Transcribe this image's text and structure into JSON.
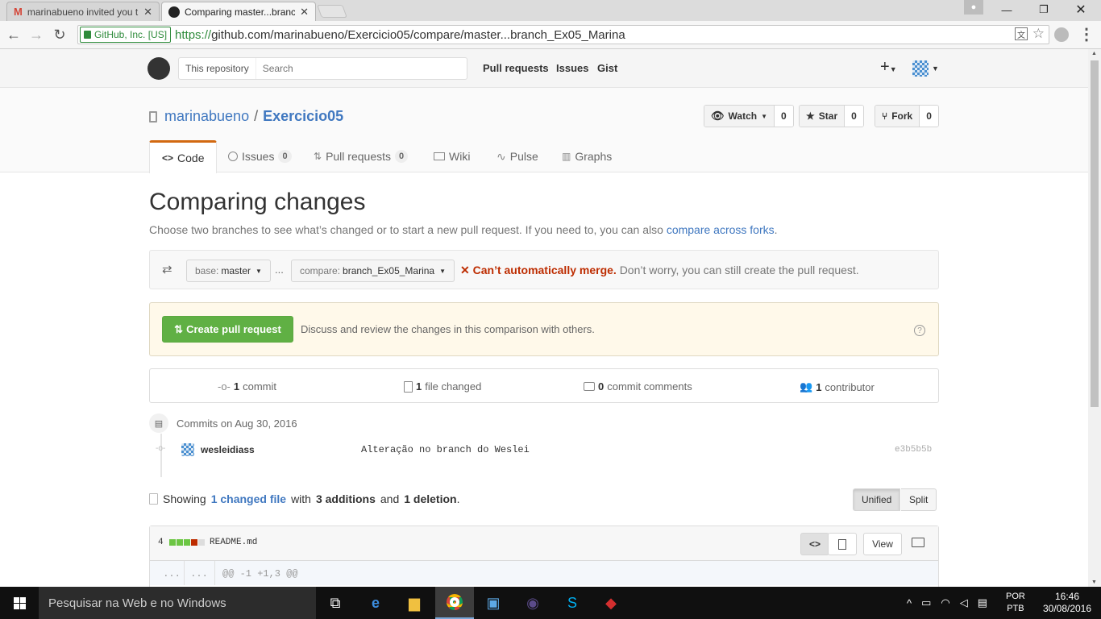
{
  "browser": {
    "tabs": [
      {
        "title": "marinabueno invited you t",
        "icon": "gmail-icon"
      },
      {
        "title": "Comparing master...branc",
        "icon": "github-icon"
      }
    ],
    "security_label": "GitHub, Inc. [US]",
    "url_scheme": "https://",
    "url_rest": "github.com/marinabueno/Exercicio05/compare/master...branch_Ex05_Marina"
  },
  "header": {
    "search_scope": "This repository",
    "search_placeholder": "Search",
    "links": [
      "Pull requests",
      "Issues",
      "Gist"
    ],
    "plus": "+"
  },
  "repo": {
    "owner": "marinabueno",
    "separator": "/",
    "name": "Exercicio05",
    "watch_label": "Watch",
    "watch_count": "0",
    "star_label": "Star",
    "star_count": "0",
    "fork_label": "Fork",
    "fork_count": "0",
    "tabs": {
      "code": "Code",
      "issues": "Issues",
      "issues_count": "0",
      "pulls": "Pull requests",
      "pulls_count": "0",
      "wiki": "Wiki",
      "pulse": "Pulse",
      "graphs": "Graphs"
    }
  },
  "compare": {
    "title": "Comparing changes",
    "desc": "Choose two branches to see what’s changed or to start a new pull request. If you need to, you can also",
    "desc_link": "compare across forks",
    "desc_end": ".",
    "base_prefix": "base:",
    "base_value": "master",
    "dots": "...",
    "compare_prefix": "compare:",
    "compare_value": "branch_Ex05_Marina",
    "merge_error": "Can’t automatically merge.",
    "merge_hint": "Don’t worry, you can still create the pull request.",
    "create_pr": "Create pull request",
    "pr_desc": "Discuss and review the changes in this comparison with others.",
    "help": "?"
  },
  "numbers": {
    "commits_n": "1",
    "commits_label": "commit",
    "files_n": "1",
    "files_label": "file changed",
    "comments_n": "0",
    "comments_label": "commit comments",
    "contrib_n": "1",
    "contrib_label": "contributor"
  },
  "commits": {
    "heading": "Commits on Aug 30, 2016",
    "author": "wesleidiass",
    "message": "Alteração no branch do Weslei",
    "sha": "e3b5b5b"
  },
  "diffstat": {
    "showing": "Showing",
    "changed_link": "1 changed file",
    "with": "with",
    "additions": "3 additions",
    "and": "and",
    "deletions": "1 deletion",
    "end": ".",
    "unified": "Unified",
    "split": "Split"
  },
  "file": {
    "count": "4",
    "name": "README.md",
    "view": "View",
    "hunk_left": "...",
    "hunk_right": "...",
    "hunk": "@@ -1 +1,3 @@",
    "bar_colors": [
      "#6cc644",
      "#6cc644",
      "#6cc644",
      "#bd2c00",
      "#dddddd"
    ]
  },
  "taskbar": {
    "search": "Pesquisar na Web e no Windows",
    "lang1": "POR",
    "lang2": "PTB",
    "time": "16:46",
    "date": "30/08/2016"
  }
}
